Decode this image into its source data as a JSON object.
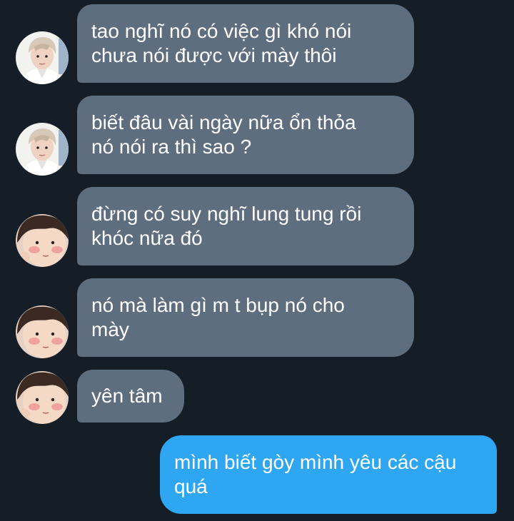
{
  "messages": [
    {
      "sender": "friend-1",
      "avatar_icon": "friend-1-avatar",
      "lines": [
        "tao nghĩ nó có việc gì khó nói",
        "chưa nói được với mày thôi"
      ]
    },
    {
      "sender": "friend-1",
      "avatar_icon": "friend-1-avatar",
      "lines": [
        "biết đâu vài ngày nữa ổn thỏa",
        "nó nói ra thì sao ?"
      ]
    },
    {
      "sender": "friend-2",
      "avatar_icon": "friend-2-avatar",
      "lines": [
        "đừng có suy nghĩ lung tung rồi",
        "khóc nữa đó"
      ]
    },
    {
      "sender": "friend-2",
      "avatar_icon": "friend-2-avatar",
      "lines": [
        "nó mà làm gì m t bụp nó cho",
        "mày"
      ]
    },
    {
      "sender": "friend-2",
      "avatar_icon": "friend-2-avatar",
      "lines": [
        "yên tâm"
      ]
    },
    {
      "sender": "me",
      "lines": [
        "mình biết gòy mình yêu các cậu",
        "quá"
      ]
    }
  ],
  "colors": {
    "background": "#151d27",
    "incoming_bubble": "#5f6e7f",
    "outgoing_bubble": "#2ea6f2",
    "text": "#ffffff"
  }
}
